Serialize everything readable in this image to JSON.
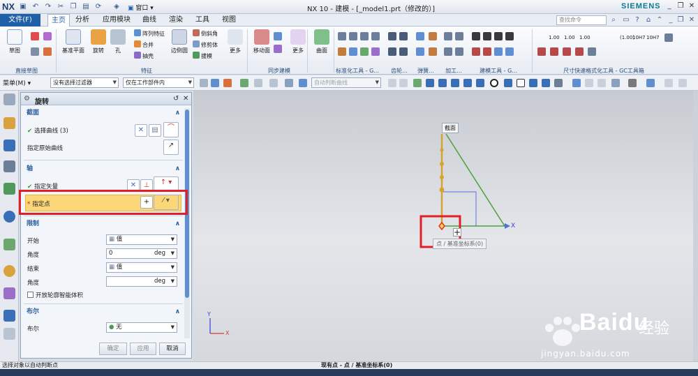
{
  "app": {
    "logo": "NX",
    "title": "NX 10 - 建模 - [_model1.prt（修改的）]",
    "brand": "SIEMENS",
    "window_menu": "窗口"
  },
  "menu": {
    "file": "文件(F)",
    "tabs": [
      "主页",
      "分析",
      "应用模块",
      "曲线",
      "渲染",
      "工具",
      "视图"
    ],
    "active_tab": "主页",
    "search_placeholder": "查找命令"
  },
  "ribbon": {
    "sketch": {
      "big": "草图",
      "group": "直接草图"
    },
    "feature": {
      "datum_plane": "基准平面",
      "revolve": "旋转",
      "hole": "孔",
      "pattern": "阵列特征",
      "unite": "合并",
      "shell": "抽壳",
      "edge_blend": "边倒圆",
      "chamfer": "倒斜角",
      "trim_body": "修剪体",
      "draft": "拔模",
      "more": "更多",
      "group": "特征"
    },
    "sync": {
      "move_face": "移动面",
      "more": "更多",
      "group": "同步建模"
    },
    "surface": {
      "label": "曲面"
    },
    "labels": [
      "标准化工具 - G...",
      "齿轮...",
      "弹簧...",
      "加工...",
      "建模工具 - G...",
      "尺寸快速格式化工具 - GC工具箱"
    ],
    "dim_labels": [
      "1.00",
      "1.00",
      "1.00",
      "(1.00)",
      "10H7",
      "10H7"
    ]
  },
  "selection_bar": {
    "menu": "菜单(M)",
    "filter": "没有选择过滤器",
    "scope": "仅在工作部件内",
    "snap": "自动判断曲线"
  },
  "dialog": {
    "title": "旋转",
    "section_section": "截面",
    "select_curve": "选择曲线 (3)",
    "specify_origin_curve": "指定原始曲线",
    "section_axis": "轴",
    "specify_vector": "指定矢量",
    "specify_point": "指定点",
    "section_limits": "限制",
    "start_label": "开始",
    "start_value": "值",
    "angle_label": "角度",
    "start_angle": "0",
    "unit": "deg",
    "end_label": "结束",
    "end_value": "值",
    "end_angle": "",
    "open_profile": "开放轮廓智能体积",
    "section_boolean": "布尔",
    "boolean_label": "布尔",
    "boolean_value": "无",
    "ok": "确定",
    "apply": "应用",
    "cancel": "取消"
  },
  "graphics": {
    "section_tag": "截面",
    "axis_x": "X",
    "axis_y": "Y",
    "tooltip": "点 / 基准坐标系(0)",
    "csys_x": "X",
    "csys_y": "Y"
  },
  "status": {
    "left": "选择对象以自动判断点",
    "middle": "现有点 - 点 / 基准坐标系(0)"
  },
  "watermark": {
    "logo_text": "Bai",
    "logo_text2": "du",
    "cn": "经验",
    "url": "jingyan.baidu.com"
  }
}
